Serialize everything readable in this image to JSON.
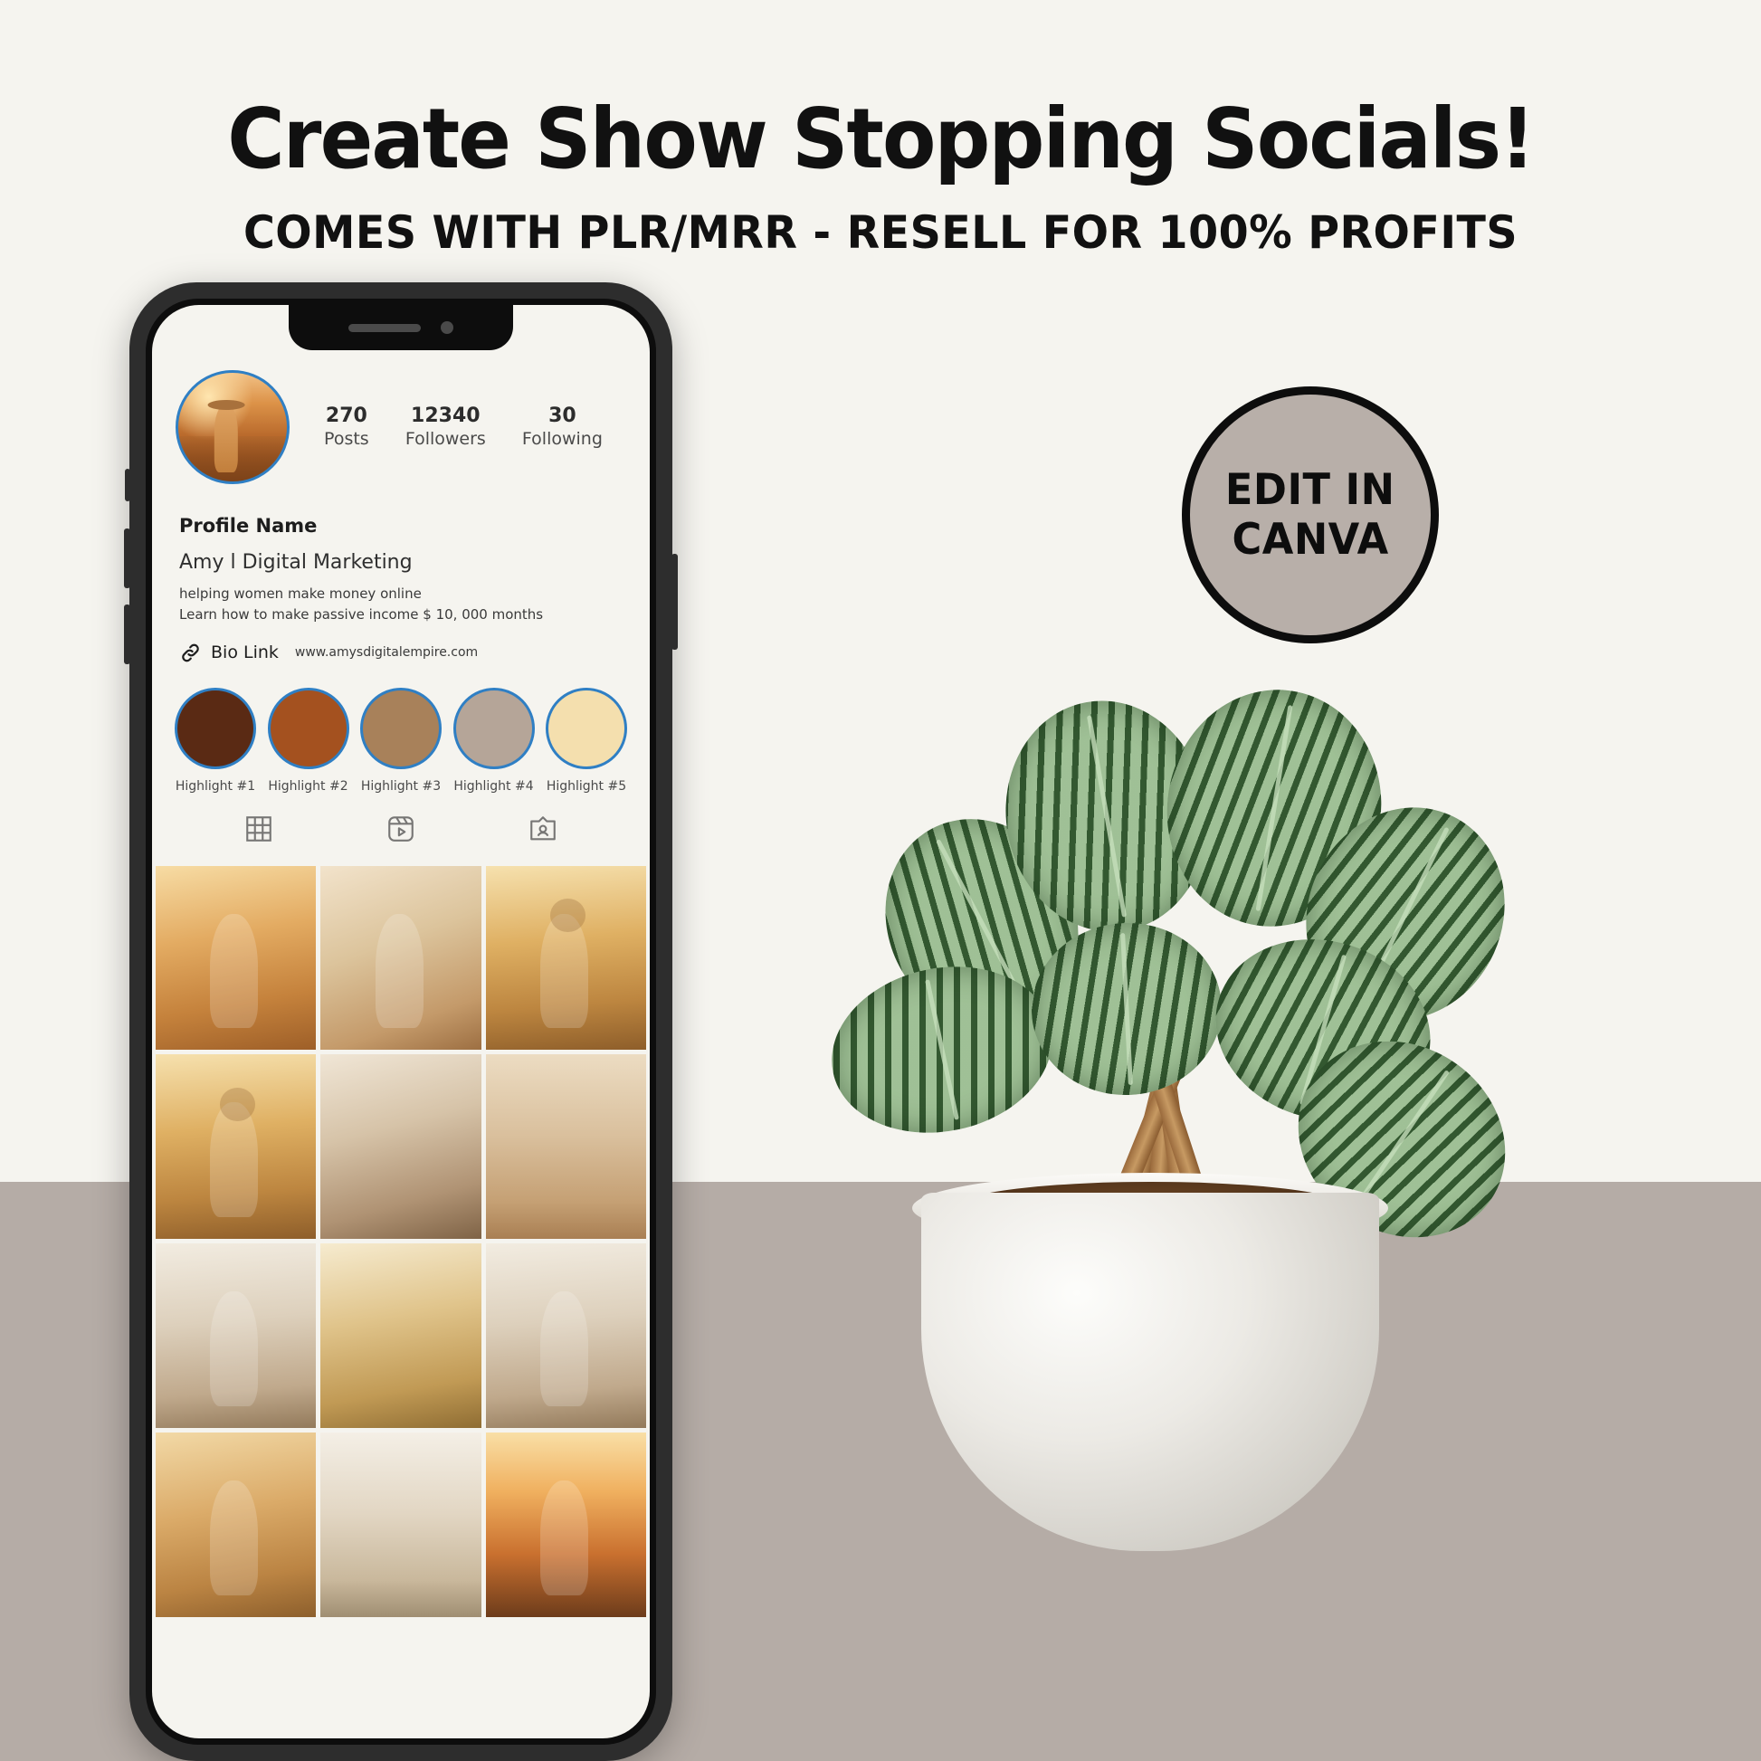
{
  "header": {
    "headline": "Create Show Stopping Socials!",
    "subheadline": "COMES WITH PLR/MRR - RESELL FOR 100% PROFITS"
  },
  "badge": {
    "line1": "EDIT IN",
    "line2": "CANVA",
    "fill_color": "#b8afa9",
    "border_color": "#0d0d0d"
  },
  "colors": {
    "background_top": "#f5f4ef",
    "background_bottom": "#b5aca6",
    "text": "#111111",
    "story_ring": "#2f7fc4"
  },
  "phone": {
    "profile": {
      "avatar_name": "profile-avatar",
      "stats": [
        {
          "value": "270",
          "label": "Posts"
        },
        {
          "value": "12340",
          "label": "Followers"
        },
        {
          "value": "30",
          "label": "Following"
        }
      ],
      "title": "Profile Name",
      "name": "Amy l Digital Marketing",
      "bio_line_1": "helping women make money online",
      "bio_line_2": "Learn  how to make passive income $ 10, 000 months",
      "link_label": "Bio Link",
      "link_url": "www.amysdigitalempire.com",
      "link_icon": "link-icon"
    },
    "highlights": [
      {
        "label": "Highlight #1",
        "color": "#5a2a14"
      },
      {
        "label": "Highlight #2",
        "color": "#a4511f"
      },
      {
        "label": "Highlight #3",
        "color": "#a8815a"
      },
      {
        "label": "Highlight #4",
        "color": "#b5a598"
      },
      {
        "label": "Highlight #5",
        "color": "#f4dfae"
      }
    ],
    "tabs": [
      {
        "name": "grid-tab",
        "icon": "grid-icon"
      },
      {
        "name": "reels-tab",
        "icon": "reels-icon"
      },
      {
        "name": "tagged-tab",
        "icon": "tagged-icon"
      }
    ],
    "grid_posts": [
      {
        "name": "post-field-woman",
        "style": "ph-sun"
      },
      {
        "name": "post-bouquet",
        "style": "ph-warm"
      },
      {
        "name": "post-hat-field",
        "style": "ph-field"
      },
      {
        "name": "post-hat-back",
        "style": "ph-field"
      },
      {
        "name": "post-laptop-desk",
        "style": "ph-desk"
      },
      {
        "name": "post-beach-wine",
        "style": "ph-beach"
      },
      {
        "name": "post-kitchen",
        "style": "ph-kitch"
      },
      {
        "name": "post-dried-flowers",
        "style": "ph-flowr"
      },
      {
        "name": "post-kitchen-window",
        "style": "ph-kitch"
      },
      {
        "name": "post-floral-dress",
        "style": "ph-dress"
      },
      {
        "name": "post-table-roses",
        "style": "ph-table"
      },
      {
        "name": "post-sunset-cliff",
        "style": "ph-sunset"
      }
    ]
  },
  "decor": {
    "plant_name": "watermelon-peperomia-plant",
    "pot_name": "textured-ceramic-pot"
  }
}
